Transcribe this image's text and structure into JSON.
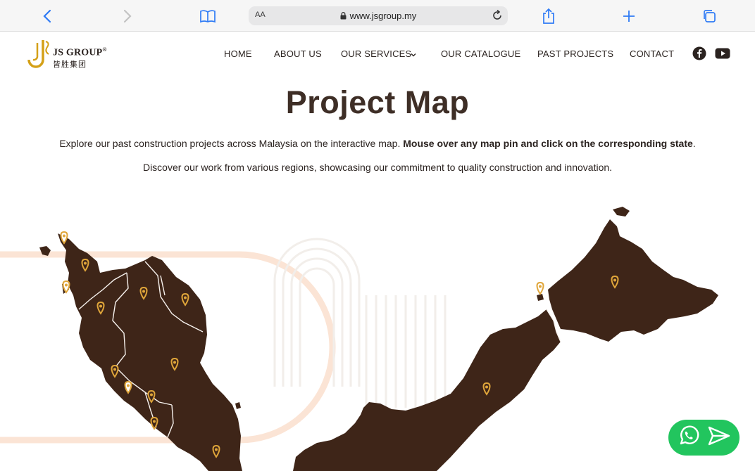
{
  "browser": {
    "text_size_label": "AA",
    "url": "www.jsgroup.my"
  },
  "logo": {
    "name": "JS GROUP",
    "registered": "®",
    "chinese_name": "皆胜集团"
  },
  "nav": {
    "items": [
      {
        "label": "HOME"
      },
      {
        "label": "ABOUT US"
      },
      {
        "label": "OUR SERVICES"
      },
      {
        "label": "OUR CATALOGUE"
      },
      {
        "label": "PAST PROJECTS"
      },
      {
        "label": "CONTACT"
      }
    ]
  },
  "social": {
    "facebook_icon": "facebook-icon",
    "youtube_icon": "youtube-icon"
  },
  "hero": {
    "title": "Project Map",
    "lead_text": "Explore our past construction projects across Malaysia on the interactive map. ",
    "lead_bold": "Mouse over any map pin and click on the corresponding state",
    "lead_end": ".",
    "sub_text": "Discover our work from various regions, showcasing our commitment to quality construction and innovation."
  },
  "colors": {
    "map_fill": "#3e2518",
    "pin": "#e0a63a",
    "accent": "#d4a017",
    "whatsapp": "#22c55e"
  },
  "chat_widget": {
    "whatsapp_icon": "whatsapp-icon",
    "send_icon": "send-icon"
  }
}
